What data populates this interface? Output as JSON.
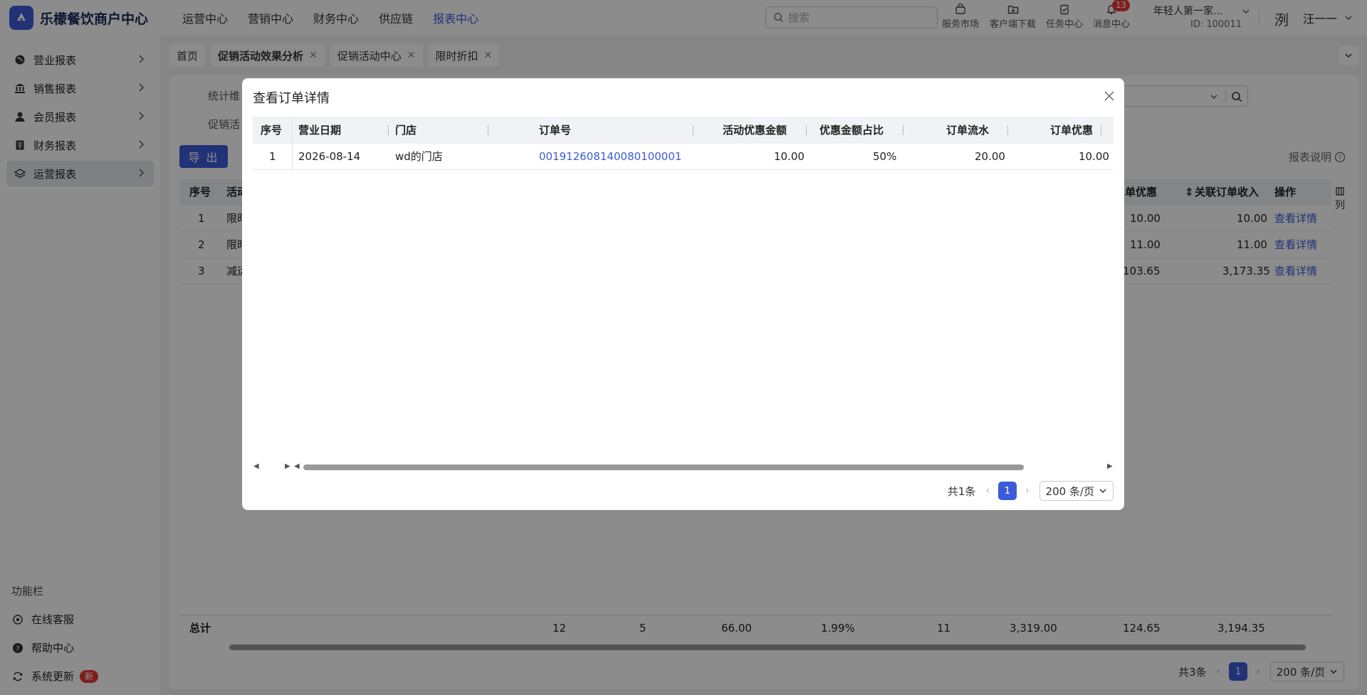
{
  "app": {
    "title": "乐檬餐饮商户中心",
    "logo_glyph": "◆"
  },
  "topnav": [
    "运营中心",
    "营销中心",
    "财务中心",
    "供应链",
    "报表中心"
  ],
  "topnav_active": "报表中心",
  "search": {
    "placeholder": "搜索"
  },
  "tools": {
    "market": "服务市场",
    "download": "客户端下载",
    "tasks": "任务中心",
    "messages": "消息中心",
    "message_count": "13"
  },
  "account": {
    "name": "年轻人第一家...",
    "id": "ID: 100011"
  },
  "user": {
    "avatar_text": "洌",
    "name": "汪一一"
  },
  "sidebar": {
    "items": [
      {
        "label": "营业报表",
        "icon": "globe-icon"
      },
      {
        "label": "销售报表",
        "icon": "bank-icon"
      },
      {
        "label": "会员报表",
        "icon": "user-icon"
      },
      {
        "label": "财务报表",
        "icon": "ledger-icon"
      },
      {
        "label": "运营报表",
        "icon": "stack-icon"
      }
    ],
    "active": "运营报表",
    "function_title": "功能栏",
    "functions": [
      {
        "label": "在线客服",
        "icon": "headset-icon"
      },
      {
        "label": "帮助中心",
        "icon": "help-icon"
      },
      {
        "label": "系统更新",
        "icon": "refresh-icon",
        "badge": "新"
      }
    ]
  },
  "tabs": [
    {
      "label": "首页",
      "closable": false
    },
    {
      "label": "促销活动效果分析",
      "closable": true
    },
    {
      "label": "促销活动中心",
      "closable": true
    },
    {
      "label": "限时折扣",
      "closable": true
    }
  ],
  "main": {
    "filter_label_1": "统计维",
    "filter_label_2": "促销活",
    "export_label": "导 出",
    "report_note": "报表说明",
    "column_setting": "列",
    "table": {
      "headers": {
        "index": "序号",
        "activity": "活动",
        "discount": "单优惠",
        "revenue": "关联订单收入",
        "action": "操作"
      },
      "rows": [
        {
          "index": "1",
          "activity": "限时",
          "discount": "10.00",
          "revenue": "10.00",
          "action": "查看详情"
        },
        {
          "index": "2",
          "activity": "限时",
          "discount": "11.00",
          "revenue": "11.00",
          "action": "查看详情"
        },
        {
          "index": "3",
          "activity": "减运",
          "discount": "103.65",
          "revenue": "3,173.35",
          "action": "查看详情"
        }
      ],
      "total": {
        "label": "总计",
        "values": [
          "12",
          "5",
          "66.00",
          "1.99%",
          "11",
          "3,319.00",
          "124.65",
          "3,194.35"
        ]
      }
    },
    "pager": {
      "total": "共3条",
      "page": "1",
      "page_size": "200 条/页"
    }
  },
  "modal": {
    "title": "查看订单详情",
    "headers": {
      "index": "序号",
      "date": "营业日期",
      "store": "门店",
      "order_no": "订单号",
      "promo_amount": "活动优惠金额",
      "promo_ratio": "优惠金额占比",
      "order_flow": "订单流水",
      "order_discount": "订单优惠"
    },
    "rows": [
      {
        "index": "1",
        "date": "2026-08-14",
        "store": "wd的门店",
        "order_no": "001912608140080100001",
        "promo_amount": "10.00",
        "promo_ratio": "50%",
        "order_flow": "20.00",
        "order_discount": "10.00"
      }
    ],
    "pager": {
      "total": "共1条",
      "page": "1",
      "page_size": "200 条/页"
    }
  },
  "colors": {
    "accent": "#3c5bd9",
    "badge": "#e53935"
  }
}
